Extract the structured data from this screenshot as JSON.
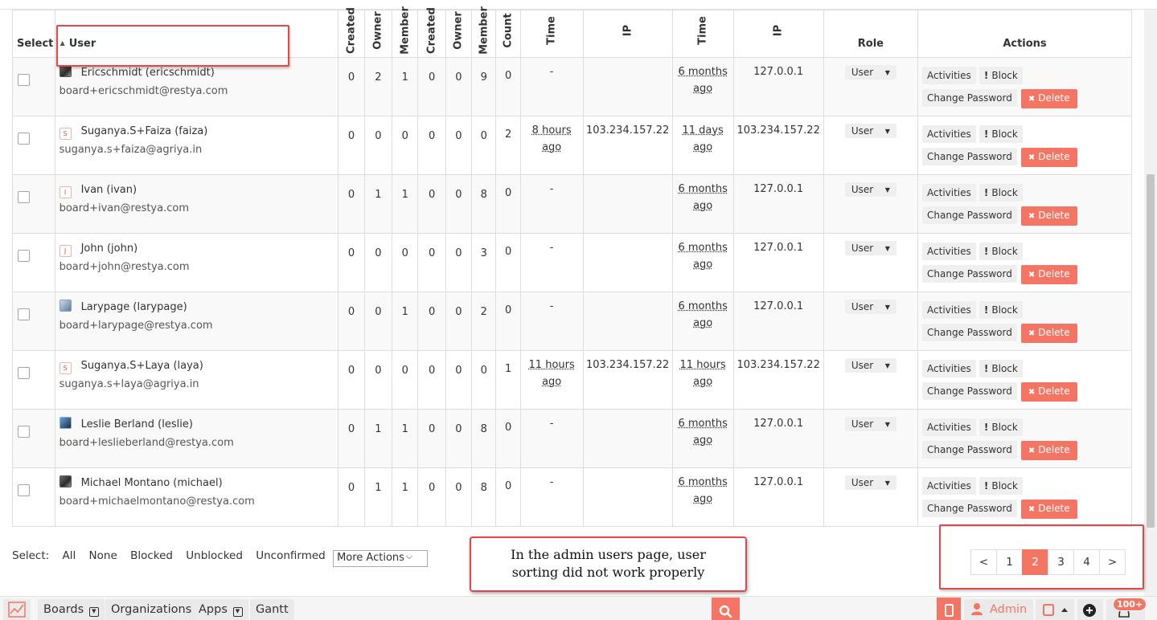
{
  "table": {
    "headers": {
      "select": "Select",
      "user": "User",
      "created1": "Created",
      "owner1": "Owner",
      "member1": "Member",
      "created2": "Created",
      "owner2": "Owner",
      "member2": "Member",
      "count": "Count",
      "time1": "Time",
      "ip1": "IP",
      "time2": "Time",
      "ip2": "IP",
      "role": "Role",
      "actions": "Actions"
    },
    "action_labels": {
      "activities": "Activities",
      "block": "Block",
      "change_password": "Change Password",
      "delete": "Delete"
    },
    "rows": [
      {
        "avatar": "photo",
        "name": "Ericschmidt (ericschmidt)",
        "email": "board+ericschmidt@restya.com",
        "c1": "0",
        "o1": "2",
        "m1": "1",
        "c2": "0",
        "o2": "0",
        "m2": "9",
        "count": "0",
        "time1_a": "-",
        "time1_b": "",
        "ip1": "",
        "time2_a": "6 months",
        "time2_b": "ago",
        "ip2": "127.0.0.1",
        "role": "User"
      },
      {
        "avatar": "S",
        "name": "Suganya.S+Faiza (faiza)",
        "email": "suganya.s+faiza@agriya.in",
        "c1": "0",
        "o1": "0",
        "m1": "0",
        "c2": "0",
        "o2": "0",
        "m2": "0",
        "count": "2",
        "time1_a": "8 hours",
        "time1_b": "ago",
        "ip1": "103.234.157.22",
        "time2_a": "11 days",
        "time2_b": "ago",
        "ip2": "103.234.157.22",
        "role": "User"
      },
      {
        "avatar": "I",
        "name": "Ivan (ivan)",
        "email": "board+ivan@restya.com",
        "c1": "0",
        "o1": "1",
        "m1": "1",
        "c2": "0",
        "o2": "0",
        "m2": "8",
        "count": "0",
        "time1_a": "-",
        "time1_b": "",
        "ip1": "",
        "time2_a": "6 months",
        "time2_b": "ago",
        "ip2": "127.0.0.1",
        "role": "User"
      },
      {
        "avatar": "J",
        "name": "John (john)",
        "email": "board+john@restya.com",
        "c1": "0",
        "o1": "0",
        "m1": "0",
        "c2": "0",
        "o2": "0",
        "m2": "3",
        "count": "0",
        "time1_a": "-",
        "time1_b": "",
        "ip1": "",
        "time2_a": "6 months",
        "time2_b": "ago",
        "ip2": "127.0.0.1",
        "role": "User"
      },
      {
        "avatar": "photo2",
        "name": "Larypage (larypage)",
        "email": "board+larypage@restya.com",
        "c1": "0",
        "o1": "0",
        "m1": "1",
        "c2": "0",
        "o2": "0",
        "m2": "2",
        "count": "0",
        "time1_a": "-",
        "time1_b": "",
        "ip1": "",
        "time2_a": "6 months",
        "time2_b": "ago",
        "ip2": "127.0.0.1",
        "role": "User"
      },
      {
        "avatar": "S",
        "name": "Suganya.S+Laya (laya)",
        "email": "suganya.s+laya@agriya.in",
        "c1": "0",
        "o1": "0",
        "m1": "0",
        "c2": "0",
        "o2": "0",
        "m2": "0",
        "count": "1",
        "time1_a": "11 hours",
        "time1_b": "ago",
        "ip1": "103.234.157.22",
        "time2_a": "11 hours",
        "time2_b": "ago",
        "ip2": "103.234.157.22",
        "role": "User"
      },
      {
        "avatar": "photo3",
        "name": "Leslie Berland (leslie)",
        "email": "board+leslieberland@restya.com",
        "c1": "0",
        "o1": "1",
        "m1": "1",
        "c2": "0",
        "o2": "0",
        "m2": "8",
        "count": "0",
        "time1_a": "-",
        "time1_b": "",
        "ip1": "",
        "time2_a": "6 months",
        "time2_b": "ago",
        "ip2": "127.0.0.1",
        "role": "User"
      },
      {
        "avatar": "photo",
        "name": "Michael Montano (michael)",
        "email": "board+michaelmontano@restya.com",
        "c1": "0",
        "o1": "1",
        "m1": "1",
        "c2": "0",
        "o2": "0",
        "m2": "8",
        "count": "0",
        "time1_a": "-",
        "time1_b": "",
        "ip1": "",
        "time2_a": "6 months",
        "time2_b": "ago",
        "ip2": "127.0.0.1",
        "role": "User"
      }
    ]
  },
  "select_bar": {
    "label": "Select:",
    "options": [
      "All",
      "None",
      "Blocked",
      "Unblocked",
      "Unconfirmed"
    ],
    "more_actions": "More Actions"
  },
  "annotation": {
    "line1": "In the admin users page, user",
    "line2": "sorting did not work properly"
  },
  "pagination": {
    "prev": "<",
    "pages": [
      "1",
      "2",
      "3",
      "4"
    ],
    "active_page": "2",
    "next": ">"
  },
  "footer": {
    "boards": "Boards",
    "organizations": "Organizations",
    "apps": "Apps",
    "gantt": "Gantt",
    "admin": "Admin",
    "notification_count": "100+"
  },
  "colors": {
    "accent": "#f47564",
    "highlight_border": "#e4464a"
  }
}
